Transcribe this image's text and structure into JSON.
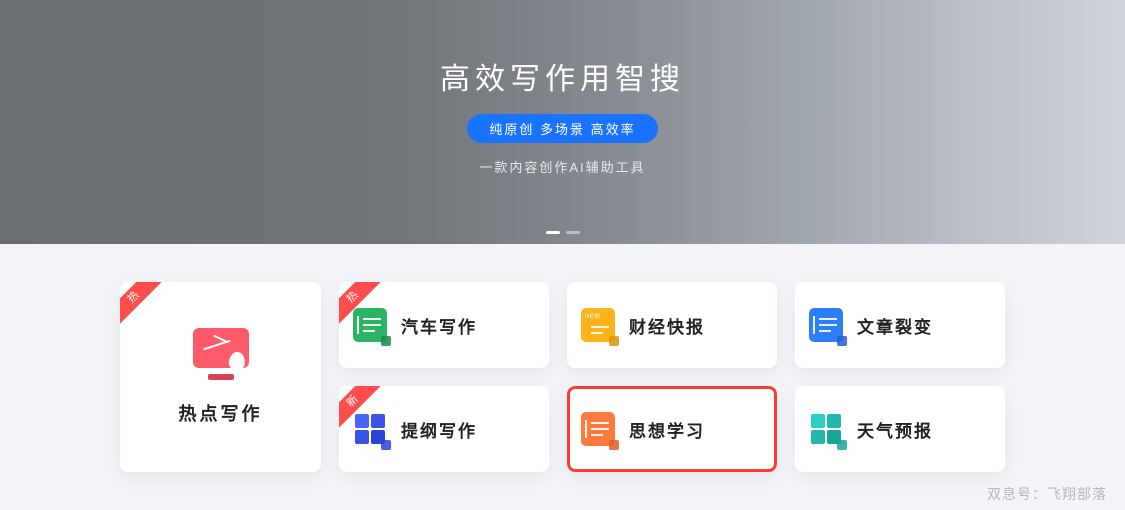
{
  "hero": {
    "title": "高效写作用智搜",
    "pill": "纯原创 多场景 高效率",
    "subtitle": "一款内容创作AI辅助工具"
  },
  "feature": {
    "ribbon": "热",
    "label": "热点写作"
  },
  "cards": {
    "r0c0": {
      "label": "汽车写作",
      "ribbon": "热",
      "color": "#2bb565",
      "tiny": "#1c8a4a"
    },
    "r0c1": {
      "label": "财经快报",
      "color": "#ffb31a",
      "tiny": "#e0940b",
      "tag": "NEW"
    },
    "r0c2": {
      "label": "文章裂变",
      "color": "#2d7dff",
      "tiny": "#1d5ed1"
    },
    "r1c0": {
      "label": "提纲写作",
      "ribbon": "新",
      "color": "#4a64ff"
    },
    "r1c1": {
      "label": "思想学习",
      "color": "#ff7a3d",
      "tiny": "#e05e27",
      "selected": true
    },
    "r1c2": {
      "label": "天气预报",
      "color": "#2dcfc4",
      "tiny": "#1aa59b"
    }
  },
  "watermark": "双息号：飞翔部落"
}
